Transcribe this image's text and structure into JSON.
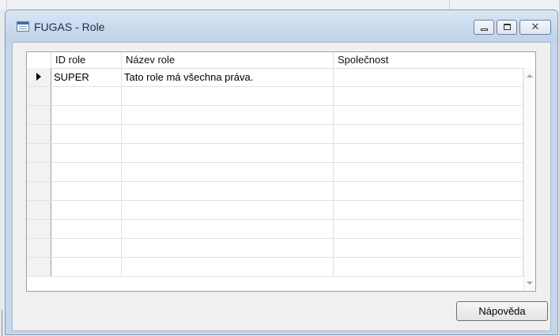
{
  "window": {
    "title": "FUGAS - Role",
    "controls": {
      "minimize_icon": "minimize-icon",
      "maximize_icon": "maximize-icon",
      "close_glyph": "✕"
    }
  },
  "table": {
    "columns": [
      "ID role",
      "Název role",
      "Společnost"
    ],
    "rows": [
      {
        "id": "SUPER",
        "name": "Tato role má všechna práva.",
        "company": "",
        "current": true
      },
      {
        "id": "",
        "name": "",
        "company": "",
        "current": false
      },
      {
        "id": "",
        "name": "",
        "company": "",
        "current": false
      },
      {
        "id": "",
        "name": "",
        "company": "",
        "current": false
      },
      {
        "id": "",
        "name": "",
        "company": "",
        "current": false
      },
      {
        "id": "",
        "name": "",
        "company": "",
        "current": false
      },
      {
        "id": "",
        "name": "",
        "company": "",
        "current": false
      },
      {
        "id": "",
        "name": "",
        "company": "",
        "current": false
      },
      {
        "id": "",
        "name": "",
        "company": "",
        "current": false
      },
      {
        "id": "",
        "name": "",
        "company": "",
        "current": false
      },
      {
        "id": "",
        "name": "",
        "company": "",
        "current": false
      }
    ]
  },
  "buttons": {
    "help_label": "Nápověda"
  }
}
